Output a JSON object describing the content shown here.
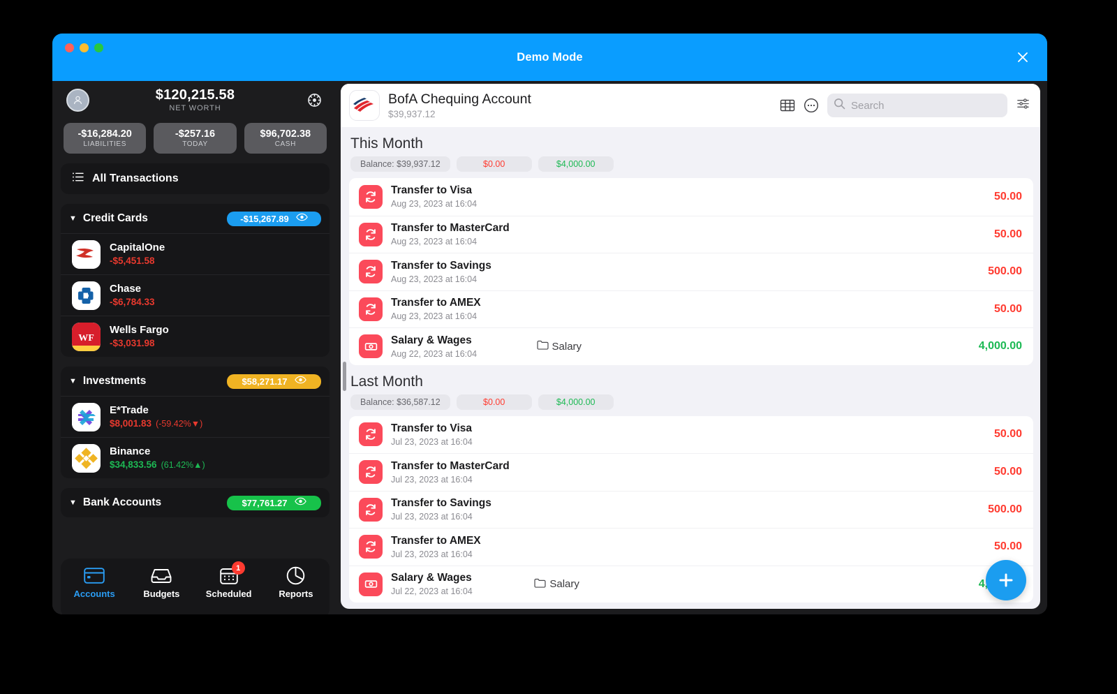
{
  "window": {
    "title": "Demo Mode",
    "close_label": "✕",
    "titlebar_color": "#0a9dff"
  },
  "sidebar": {
    "net_worth": {
      "value": "$120,215.58",
      "label": "NET WORTH"
    },
    "stats": [
      {
        "value": "-$16,284.20",
        "label": "LIABILITIES"
      },
      {
        "value": "-$257.16",
        "label": "TODAY"
      },
      {
        "value": "$96,702.38",
        "label": "CASH"
      }
    ],
    "all_transactions": "All Transactions",
    "groups": [
      {
        "title": "Credit Cards",
        "total": "-$15,267.89",
        "pill_color": "#1b9df0",
        "accounts": [
          {
            "name": "CapitalOne",
            "balance": "-$5,451.58",
            "balance_color": "#e8392e",
            "change": ""
          },
          {
            "name": "Chase",
            "balance": "-$6,784.33",
            "balance_color": "#e8392e",
            "change": ""
          },
          {
            "name": "Wells Fargo",
            "balance": "-$3,031.98",
            "balance_color": "#e8392e",
            "change": ""
          }
        ]
      },
      {
        "title": "Investments",
        "total": "$58,271.17",
        "pill_color": "#f0b323",
        "accounts": [
          {
            "name": "E*Trade",
            "balance": "$8,001.83",
            "balance_color": "#e8392e",
            "change": "(-59.42%▼)"
          },
          {
            "name": "Binance",
            "balance": "$34,833.56",
            "balance_color": "#1db954",
            "change": "(61.42%▲)"
          }
        ]
      },
      {
        "title": "Bank Accounts",
        "total": "$77,761.27",
        "pill_color": "#17c24a",
        "accounts": []
      }
    ],
    "tabs": [
      {
        "label": "Accounts",
        "icon": "credit-card-icon",
        "active": true,
        "badge": ""
      },
      {
        "label": "Budgets",
        "icon": "tray-icon",
        "active": false,
        "badge": ""
      },
      {
        "label": "Scheduled",
        "icon": "calendar-icon",
        "active": false,
        "badge": "1"
      },
      {
        "label": "Reports",
        "icon": "pie-chart-icon",
        "active": false,
        "badge": ""
      }
    ]
  },
  "main": {
    "account_name": "BofA Chequing Account",
    "account_balance": "$39,937.12",
    "search_placeholder": "Search",
    "search_value": "",
    "sections": [
      {
        "title": "This Month",
        "chips": {
          "balance": "Balance: $39,937.12",
          "negative": "$0.00",
          "positive": "$4,000.00"
        },
        "transactions": [
          {
            "name": "Transfer to Visa",
            "date": "Aug 23, 2023 at 16:04",
            "category": "",
            "amount": "50.00",
            "sign": "neg",
            "icon": "repeat-icon"
          },
          {
            "name": "Transfer to MasterCard",
            "date": "Aug 23, 2023 at 16:04",
            "category": "",
            "amount": "50.00",
            "sign": "neg",
            "icon": "repeat-icon"
          },
          {
            "name": "Transfer to Savings",
            "date": "Aug 23, 2023 at 16:04",
            "category": "",
            "amount": "500.00",
            "sign": "neg",
            "icon": "repeat-icon"
          },
          {
            "name": "Transfer to AMEX",
            "date": "Aug 23, 2023 at 16:04",
            "category": "",
            "amount": "50.00",
            "sign": "neg",
            "icon": "repeat-icon"
          },
          {
            "name": "Salary & Wages",
            "date": "Aug 22, 2023 at 16:04",
            "category": "Salary",
            "amount": "4,000.00",
            "sign": "pos",
            "icon": "banknote-icon"
          }
        ]
      },
      {
        "title": "Last Month",
        "chips": {
          "balance": "Balance: $36,587.12",
          "negative": "$0.00",
          "positive": "$4,000.00"
        },
        "transactions": [
          {
            "name": "Transfer to Visa",
            "date": "Jul 23, 2023 at 16:04",
            "category": "",
            "amount": "50.00",
            "sign": "neg",
            "icon": "repeat-icon"
          },
          {
            "name": "Transfer to MasterCard",
            "date": "Jul 23, 2023 at 16:04",
            "category": "",
            "amount": "50.00",
            "sign": "neg",
            "icon": "repeat-icon"
          },
          {
            "name": "Transfer to Savings",
            "date": "Jul 23, 2023 at 16:04",
            "category": "",
            "amount": "500.00",
            "sign": "neg",
            "icon": "repeat-icon"
          },
          {
            "name": "Transfer to AMEX",
            "date": "Jul 23, 2023 at 16:04",
            "category": "",
            "amount": "50.00",
            "sign": "neg",
            "icon": "repeat-icon"
          },
          {
            "name": "Salary & Wages",
            "date": "Jul 22, 2023 at 16:04",
            "category": "Salary",
            "amount": "4,000.00",
            "sign": "pos",
            "icon": "banknote-icon"
          }
        ]
      }
    ],
    "fab_label": "+"
  }
}
